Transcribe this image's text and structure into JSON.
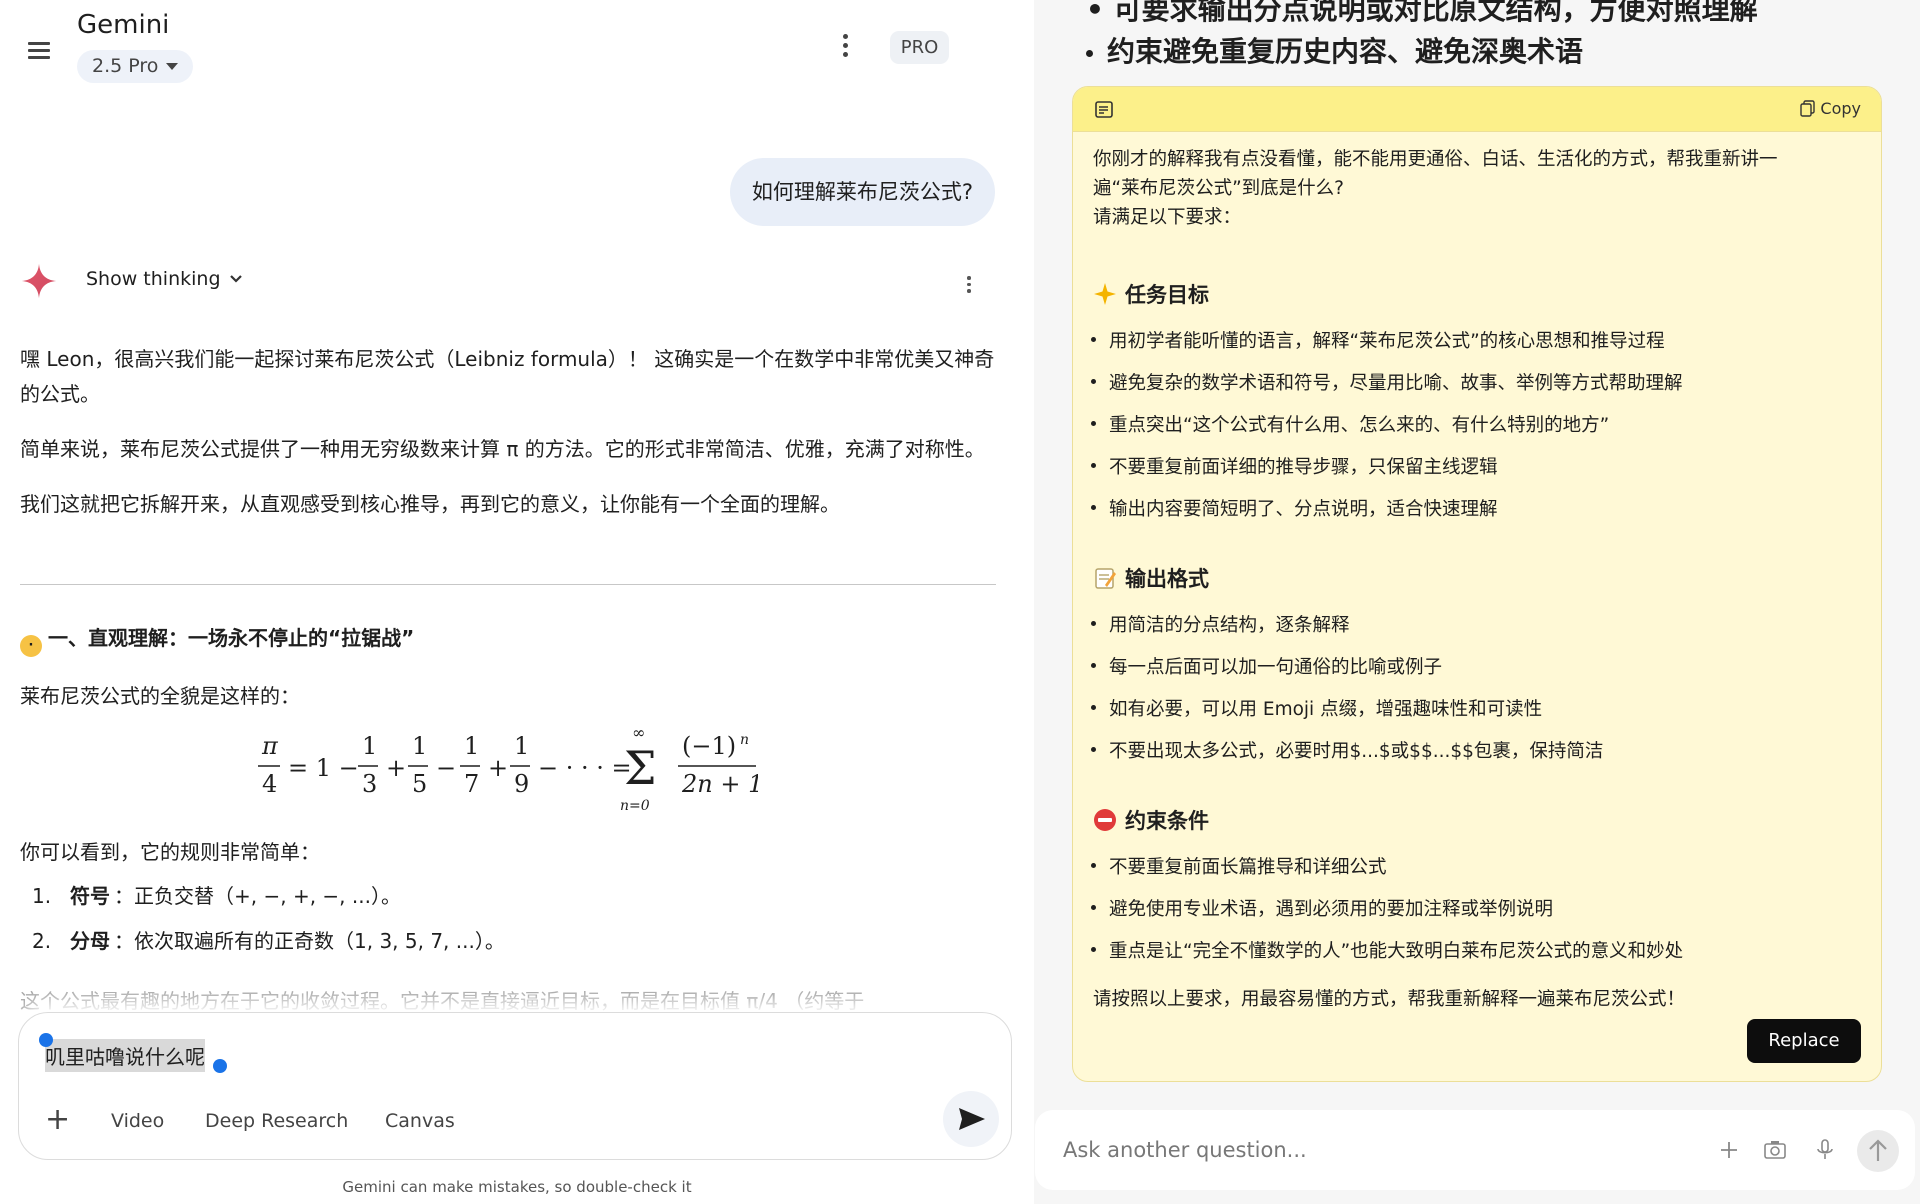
{
  "header": {
    "app_title": "Gemini",
    "model_label": "2.5 Pro",
    "pro_badge": "PRO"
  },
  "chat": {
    "user_message": "如何理解莱布尼茨公式?",
    "show_thinking_label": "Show thinking",
    "answer_paragraphs": [
      "嘿 Leon，很高兴我们能一起探讨莱布尼茨公式（Leibniz formula）！ 这确实是一个在数学中非常优美又神奇的公式。",
      "简单来说，莱布尼茨公式提供了一种用无穷级数来计算 π 的方法。它的形式非常简洁、优雅，充满了对称性。",
      "我们这就把它拆解开来，从直观感受到核心推导，再到它的意义，让你能有一个全面的理解。"
    ],
    "section_heading": "一、直观理解：一场永不停止的“拉锯战”",
    "formula_intro": "莱布尼茨公式的全貌是这样的：",
    "rules_intro": "你可以看到，它的规则非常简单：",
    "rules": [
      {
        "num": "1.",
        "term": "符号",
        "desc": "：正负交替（+, −, +, −, ...）。"
      },
      {
        "num": "2.",
        "term": "分母",
        "desc": "：依次取遍所有的正奇数（1, 3, 5, 7, ...）。"
      }
    ],
    "faded_text": "这个公式最有趣的地方在于它的收敛过程。它并不是直接逼近目标，而是在目标值 π/4 （约等于"
  },
  "composer": {
    "input_text": "叽里咕噜说什么呢",
    "tools": [
      "Video",
      "Deep Research",
      "Canvas"
    ],
    "disclaimer": "Gemini can make mistakes, so double-check it"
  },
  "right_panel": {
    "top_bullets": [
      "• 可要求输出分点说明或对比原文结构，方便对照理解",
      "约束避免重复历史内容、避免深奥术语"
    ],
    "card": {
      "copy_label": "Copy",
      "intro_lines": [
        "你刚才的解释我有点没看懂，能不能用更通俗、白话、生活化的方式，帮我重新讲一",
        "遍“莱布尼茨公式”到底是什么?",
        "请满足以下要求："
      ],
      "sections": [
        {
          "title": "任务目标",
          "items": [
            "用初学者能听懂的语言，解释“莱布尼茨公式”的核心思想和推导过程",
            "避免复杂的数学术语和符号，尽量用比喻、故事、举例等方式帮助理解",
            "重点突出“这个公式有什么用、怎么来的、有什么特别的地方”",
            "不要重复前面详细的推导步骤，只保留主线逻辑",
            "输出内容要简短明了、分点说明，适合快速理解"
          ]
        },
        {
          "title": "输出格式",
          "items": [
            "用简洁的分点结构，逐条解释",
            "每一点后面可以加一句通俗的比喻或例子",
            "如有必要，可以用 Emoji 点缀，增强趣味性和可读性",
            "不要出现太多公式，必要时用$...$或$$...$$包裹，保持简洁"
          ]
        },
        {
          "title": "约束条件",
          "items": [
            "不要重复前面长篇推导和详细公式",
            "避免使用专业术语，遇到必须用的要加注释或举例说明",
            "重点是让“完全不懂数学的人”也能大致明白莱布尼茨公式的意义和妙处"
          ]
        }
      ],
      "final_line": "请按照以上要求，用最容易懂的方式，帮我重新解释一遍莱布尼茨公式！",
      "replace_label": "Replace"
    },
    "ask_placeholder": "Ask another question..."
  },
  "colors": {
    "accent_blue": "#1a73e8",
    "card_bg": "#fff9d6",
    "card_header": "#fcf08a",
    "user_bubble": "#e8eef8"
  }
}
